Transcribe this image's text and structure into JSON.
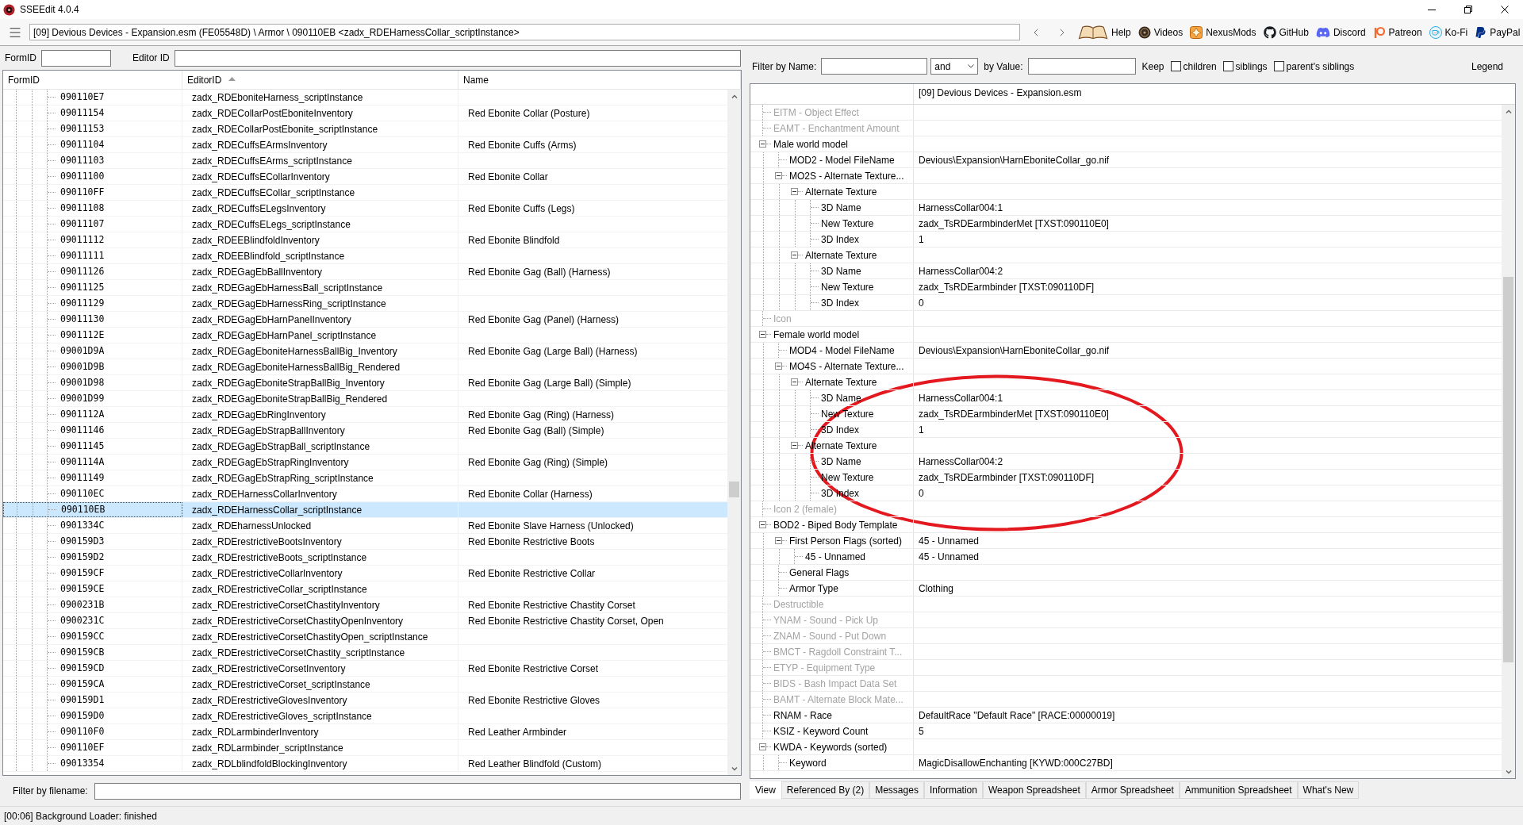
{
  "window": {
    "title": "SSEEdit 4.0.4"
  },
  "toolbar": {
    "path": "[09] Devious Devices - Expansion.esm (FE05548D) \\ Armor \\ 090110EB <zadx_RDEHarnessCollar_scriptInstance>",
    "links": [
      {
        "label": "Help"
      },
      {
        "label": "Videos"
      },
      {
        "label": "NexusMods"
      },
      {
        "label": "GitHub"
      },
      {
        "label": "Discord"
      },
      {
        "label": "Patreon"
      },
      {
        "label": "Ko-Fi"
      },
      {
        "label": "PayPal"
      }
    ]
  },
  "left_pane": {
    "form_id_filter": {
      "label": "FormID"
    },
    "editor_id_filter": {
      "label": "Editor ID"
    },
    "table": {
      "columns": [
        {
          "label": "FormID",
          "sorted": false
        },
        {
          "label": "EditorID",
          "sorted": true
        },
        {
          "label": "Name",
          "sorted": false
        }
      ],
      "rows": [
        {
          "form_id": "090110E7",
          "editor_id": "zadx_RDEboniteHarness_scriptInstance",
          "selected": false
        },
        {
          "form_id": "09011154",
          "editor_id": "zadx_RDECollarPostEboniteInventory",
          "name": "Red Ebonite Collar (Posture)",
          "selected": false
        },
        {
          "form_id": "09011153",
          "editor_id": "zadx_RDECollarPostEbonite_scriptInstance",
          "selected": false
        },
        {
          "form_id": "09011104",
          "editor_id": "zadx_RDECuffsEArmsInventory",
          "name": "Red Ebonite Cuffs (Arms)",
          "selected": false
        },
        {
          "form_id": "09011103",
          "editor_id": "zadx_RDECuffsEArms_scriptInstance",
          "selected": false
        },
        {
          "form_id": "09011100",
          "editor_id": "zadx_RDECuffsECollarInventory",
          "name": "Red Ebonite Collar",
          "selected": false
        },
        {
          "form_id": "090110FF",
          "editor_id": "zadx_RDECuffsECollar_scriptInstance",
          "selected": false
        },
        {
          "form_id": "09011108",
          "editor_id": "zadx_RDECuffsELegsInventory",
          "name": "Red Ebonite Cuffs (Legs)",
          "selected": false
        },
        {
          "form_id": "09011107",
          "editor_id": "zadx_RDECuffsELegs_scriptInstance",
          "selected": false
        },
        {
          "form_id": "09011112",
          "editor_id": "zadx_RDEEBlindfoldInventory",
          "name": "Red Ebonite Blindfold",
          "selected": false
        },
        {
          "form_id": "09011111",
          "editor_id": "zadx_RDEEBlindfold_scriptInstance",
          "selected": false
        },
        {
          "form_id": "09011126",
          "editor_id": "zadx_RDEGagEbBallInventory",
          "name": "Red Ebonite Gag (Ball) (Harness)",
          "selected": false
        },
        {
          "form_id": "09011125",
          "editor_id": "zadx_RDEGagEbHarnessBall_scriptInstance",
          "selected": false
        },
        {
          "form_id": "09011129",
          "editor_id": "zadx_RDEGagEbHarnessRing_scriptInstance",
          "selected": false
        },
        {
          "form_id": "09011130",
          "editor_id": "zadx_RDEGagEbHarnPanelInventory",
          "name": "Red Ebonite Gag (Panel) (Harness)",
          "selected": false
        },
        {
          "form_id": "0901112E",
          "editor_id": "zadx_RDEGagEbHarnPanel_scriptInstance",
          "selected": false
        },
        {
          "form_id": "09001D9A",
          "editor_id": "zadx_RDEGagEboniteHarnessBallBig_Inventory",
          "name": "Red Ebonite Gag (Large Ball) (Harness)",
          "selected": false
        },
        {
          "form_id": "09001D9B",
          "editor_id": "zadx_RDEGagEboniteHarnessBallBig_Rendered",
          "selected": false
        },
        {
          "form_id": "09001D98",
          "editor_id": "zadx_RDEGagEboniteStrapBallBig_Inventory",
          "name": "Red Ebonite Gag (Large Ball) (Simple)",
          "selected": false
        },
        {
          "form_id": "09001D99",
          "editor_id": "zadx_RDEGagEboniteStrapBallBig_Rendered",
          "selected": false
        },
        {
          "form_id": "0901112A",
          "editor_id": "zadx_RDEGagEbRingInventory",
          "name": "Red Ebonite Gag (Ring) (Harness)",
          "selected": false
        },
        {
          "form_id": "09011146",
          "editor_id": "zadx_RDEGagEbStrapBallInventory",
          "name": "Red Ebonite Gag (Ball) (Simple)",
          "selected": false
        },
        {
          "form_id": "09011145",
          "editor_id": "zadx_RDEGagEbStrapBall_scriptInstance",
          "selected": false
        },
        {
          "form_id": "0901114A",
          "editor_id": "zadx_RDEGagEbStrapRingInventory",
          "name": "Red Ebonite Gag (Ring) (Simple)",
          "selected": false
        },
        {
          "form_id": "09011149",
          "editor_id": "zadx_RDEGagEbStrapRing_scriptInstance",
          "selected": false
        },
        {
          "form_id": "090110EC",
          "editor_id": "zadx_RDEHarnessCollarInventory",
          "name": "Red Ebonite Collar (Harness)",
          "selected": false
        },
        {
          "form_id": "090110EB",
          "editor_id": "zadx_RDEHarnessCollar_scriptInstance",
          "selected": true
        },
        {
          "form_id": "0901334C",
          "editor_id": "zadx_RDEharnessUnlocked",
          "name": "Red Ebonite Slave Harness (Unlocked)",
          "selected": false
        },
        {
          "form_id": "090159D3",
          "editor_id": "zadx_RDErestrictiveBootsInventory",
          "name": "Red Ebonite Restrictive Boots",
          "selected": false
        },
        {
          "form_id": "090159D2",
          "editor_id": "zadx_RDErestrictiveBoots_scriptInstance",
          "selected": false
        },
        {
          "form_id": "090159CF",
          "editor_id": "zadx_RDErestrictiveCollarInventory",
          "name": "Red Ebonite Restrictive Collar",
          "selected": false
        },
        {
          "form_id": "090159CE",
          "editor_id": "zadx_RDErestrictiveCollar_scriptInstance",
          "selected": false
        },
        {
          "form_id": "0900231B",
          "editor_id": "zadx_RDErestrictiveCorsetChastityInventory",
          "name": "Red Ebonite Restrictive Chastity Corset",
          "selected": false
        },
        {
          "form_id": "0900231C",
          "editor_id": "zadx_RDErestrictiveCorsetChastityOpenInventory",
          "name": "Red Ebonite Restrictive Chastity Corset, Open",
          "selected": false
        },
        {
          "form_id": "090159CC",
          "editor_id": "zadx_RDErestrictiveCorsetChastityOpen_scriptInstance",
          "selected": false
        },
        {
          "form_id": "090159CB",
          "editor_id": "zadx_RDErestrictiveCorsetChastity_scriptInstance",
          "selected": false
        },
        {
          "form_id": "090159CD",
          "editor_id": "zadx_RDErestrictiveCorsetInventory",
          "name": "Red Ebonite Restrictive Corset",
          "selected": false
        },
        {
          "form_id": "090159CA",
          "editor_id": "zadx_RDErestrictiveCorset_scriptInstance",
          "selected": false
        },
        {
          "form_id": "090159D1",
          "editor_id": "zadx_RDErestrictiveGlovesInventory",
          "name": "Red Ebonite Restrictive Gloves",
          "selected": false
        },
        {
          "form_id": "090159D0",
          "editor_id": "zadx_RDErestrictiveGloves_scriptInstance",
          "selected": false
        },
        {
          "form_id": "090110F0",
          "editor_id": "zadx_RDLarmbinderInventory",
          "name": "Red Leather Armbinder",
          "selected": false
        },
        {
          "form_id": "090110EF",
          "editor_id": "zadx_RDLarmbinder_scriptInstance",
          "selected": false
        },
        {
          "form_id": "09013354",
          "editor_id": "zadx_RDLblindfoldBlockingInventory",
          "name": "Red Leather Blindfold (Custom)",
          "selected": false
        }
      ]
    },
    "filename_filter": {
      "label": "Filter by filename:"
    }
  },
  "right_pane": {
    "filter": {
      "name_label": "Filter by Name:",
      "operator": "and",
      "value_label": "by Value:",
      "keep_label": "Keep",
      "keep_options": [
        {
          "label": "children",
          "checked": false
        },
        {
          "label": "siblings",
          "checked": false
        },
        {
          "label": "parent's siblings",
          "checked": false
        }
      ],
      "legend": "Legend"
    },
    "record_view": {
      "header": "[09] Devious Devices - Expansion.esm",
      "rows": [
        {
          "label": "EITM - Object Effect",
          "disabled": true
        },
        {
          "label": "EAMT - Enchantment Amount",
          "disabled": true
        },
        {
          "label": "Male world model",
          "disabled": false,
          "expanded": true,
          "children": [
            {
              "label": "MOD2 - Model FileName",
              "value": "Devious\\Expansion\\HarnEboniteCollar_go.nif",
              "disabled": false
            },
            {
              "label": "MO2S - Alternate Texture...",
              "disabled": false,
              "expanded": true,
              "children": [
                {
                  "label": "Alternate Texture",
                  "disabled": false,
                  "expanded": true,
                  "children": [
                    {
                      "label": "3D Name",
                      "value": "HarnessCollar004:1",
                      "disabled": false
                    },
                    {
                      "label": "New Texture",
                      "value": "zadx_TsRDEarmbinderMet [TXST:090110E0]",
                      "disabled": false
                    },
                    {
                      "label": "3D Index",
                      "value": "1",
                      "disabled": false
                    }
                  ]
                },
                {
                  "label": "Alternate Texture",
                  "disabled": false,
                  "expanded": true,
                  "children": [
                    {
                      "label": "3D Name",
                      "value": "HarnessCollar004:2",
                      "disabled": false
                    },
                    {
                      "label": "New Texture",
                      "value": "zadx_TsRDEarmbinder [TXST:090110DF]",
                      "disabled": false
                    },
                    {
                      "label": "3D Index",
                      "value": "0",
                      "disabled": false
                    }
                  ]
                }
              ]
            }
          ]
        },
        {
          "label": "Icon",
          "disabled": true
        },
        {
          "label": "Female world model",
          "disabled": false,
          "expanded": true,
          "children": [
            {
              "label": "MOD4 - Model FileName",
              "value": "Devious\\Expansion\\HarnEboniteCollar_go.nif",
              "disabled": false
            },
            {
              "label": "MO4S - Alternate Texture...",
              "disabled": false,
              "expanded": true,
              "children": [
                {
                  "label": "Alternate Texture",
                  "disabled": false,
                  "expanded": true,
                  "children": [
                    {
                      "label": "3D Name",
                      "value": "HarnessCollar004:1",
                      "disabled": false
                    },
                    {
                      "label": "New Texture",
                      "value": "zadx_TsRDEarmbinderMet [TXST:090110E0]",
                      "disabled": false
                    },
                    {
                      "label": "3D Index",
                      "value": "1",
                      "disabled": false
                    }
                  ]
                },
                {
                  "label": "Alternate Texture",
                  "disabled": false,
                  "expanded": true,
                  "children": [
                    {
                      "label": "3D Name",
                      "value": "HarnessCollar004:2",
                      "disabled": false
                    },
                    {
                      "label": "New Texture",
                      "value": "zadx_TsRDEarmbinder [TXST:090110DF]",
                      "disabled": false
                    },
                    {
                      "label": "3D Index",
                      "value": "0",
                      "disabled": false
                    }
                  ]
                }
              ]
            }
          ]
        },
        {
          "label": "Icon 2 (female)",
          "disabled": true
        },
        {
          "label": "BOD2 - Biped Body Template",
          "disabled": false,
          "expanded": true,
          "children": [
            {
              "label": "First Person Flags (sorted)",
              "value": "45 - Unnamed",
              "disabled": false,
              "expanded": true,
              "children": [
                {
                  "label": "45 - Unnamed",
                  "value": "45 - Unnamed",
                  "disabled": false
                }
              ]
            },
            {
              "label": "General Flags",
              "disabled": false
            },
            {
              "label": "Armor Type",
              "value": "Clothing",
              "disabled": false
            }
          ]
        },
        {
          "label": "Destructible",
          "disabled": true
        },
        {
          "label": "YNAM - Sound - Pick Up",
          "disabled": true
        },
        {
          "label": "ZNAM - Sound - Put Down",
          "disabled": true
        },
        {
          "label": "BMCT - Ragdoll Constraint T...",
          "disabled": true
        },
        {
          "label": "ETYP - Equipment Type",
          "disabled": true
        },
        {
          "label": "BIDS - Bash Impact Data Set",
          "disabled": true
        },
        {
          "label": "BAMT - Alternate Block Mate...",
          "disabled": true
        },
        {
          "label": "RNAM - Race",
          "value": "DefaultRace \"Default Race\" [RACE:00000019]",
          "disabled": false
        },
        {
          "label": "KSIZ - Keyword Count",
          "value": "5",
          "disabled": false
        },
        {
          "label": "KWDA - Keywords (sorted)",
          "disabled": false,
          "expanded": true,
          "children": [
            {
              "label": "Keyword",
              "value": "MagicDisallowEnchanting [KYWD:000C27BD]",
              "disabled": false
            }
          ]
        }
      ]
    },
    "tabs": [
      {
        "label": "View",
        "selected": true
      },
      {
        "label": "Referenced By (2)",
        "selected": false
      },
      {
        "label": "Messages",
        "selected": false
      },
      {
        "label": "Information",
        "selected": false
      },
      {
        "label": "Weapon Spreadsheet",
        "selected": false
      },
      {
        "label": "Armor Spreadsheet",
        "selected": false
      },
      {
        "label": "Ammunition Spreadsheet",
        "selected": false
      },
      {
        "label": "What's New",
        "selected": false
      }
    ]
  },
  "overlay": {
    "kind": "ellipse"
  },
  "status_bar": {
    "text": "[00:06] Background Loader: finished"
  }
}
